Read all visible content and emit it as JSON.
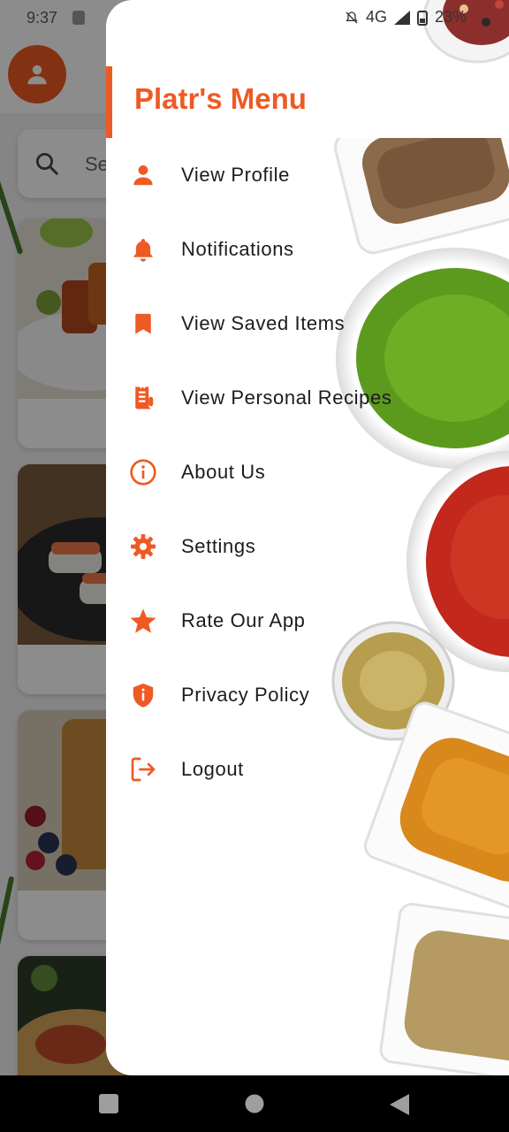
{
  "status_bar": {
    "time": "9:37",
    "network": "4G",
    "battery": "23%"
  },
  "background": {
    "search_placeholder": "Se"
  },
  "drawer": {
    "title": "Platr's Menu",
    "accent_color": "#ee5a24",
    "items": [
      {
        "label": "View Profile",
        "icon": "person-icon"
      },
      {
        "label": "Notifications",
        "icon": "bell-icon"
      },
      {
        "label": "View Saved Items",
        "icon": "bookmark-icon"
      },
      {
        "label": "View Personal Recipes",
        "icon": "receipt-icon"
      },
      {
        "label": "About Us",
        "icon": "info-icon"
      },
      {
        "label": "Settings",
        "icon": "gear-icon"
      },
      {
        "label": "Rate Our App",
        "icon": "star-icon"
      },
      {
        "label": "Privacy Policy",
        "icon": "shield-icon"
      },
      {
        "label": "Logout",
        "icon": "logout-icon"
      }
    ]
  },
  "nav_bar": {
    "buttons": [
      "recents-button",
      "home-button",
      "back-button"
    ]
  }
}
